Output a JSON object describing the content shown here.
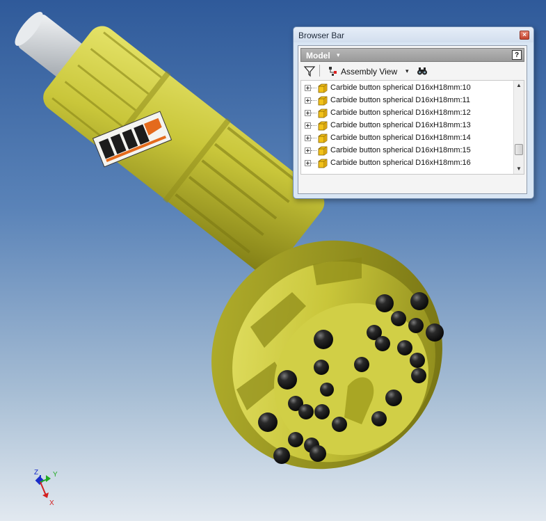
{
  "browser_bar": {
    "title": "Browser Bar",
    "close_label": "×",
    "model_label": "Model",
    "model_dropdown_arrow": "▾",
    "help_label": "?",
    "assembly_view_label": "Assembly View",
    "assembly_view_dropdown_arrow": "▾",
    "tree_items": [
      {
        "label": "Carbide button spherical D16xH18mm:10"
      },
      {
        "label": "Carbide button spherical D16xH18mm:11"
      },
      {
        "label": "Carbide button spherical D16xH18mm:12"
      },
      {
        "label": "Carbide button spherical D16xH18mm:13"
      },
      {
        "label": "Carbide button spherical D16xH18mm:14"
      },
      {
        "label": "Carbide button spherical D16xH18mm:15"
      },
      {
        "label": "Carbide button spherical D16xH18mm:16"
      }
    ],
    "scroll_position": 0.85
  },
  "view_triad": {
    "z_label": "Z",
    "y_label": "Y",
    "x_label": "X"
  },
  "colors": {
    "body_yellow": "#c8c63a",
    "carbide_black": "#1a1a1a",
    "shank_grey": "#d9dde2"
  }
}
